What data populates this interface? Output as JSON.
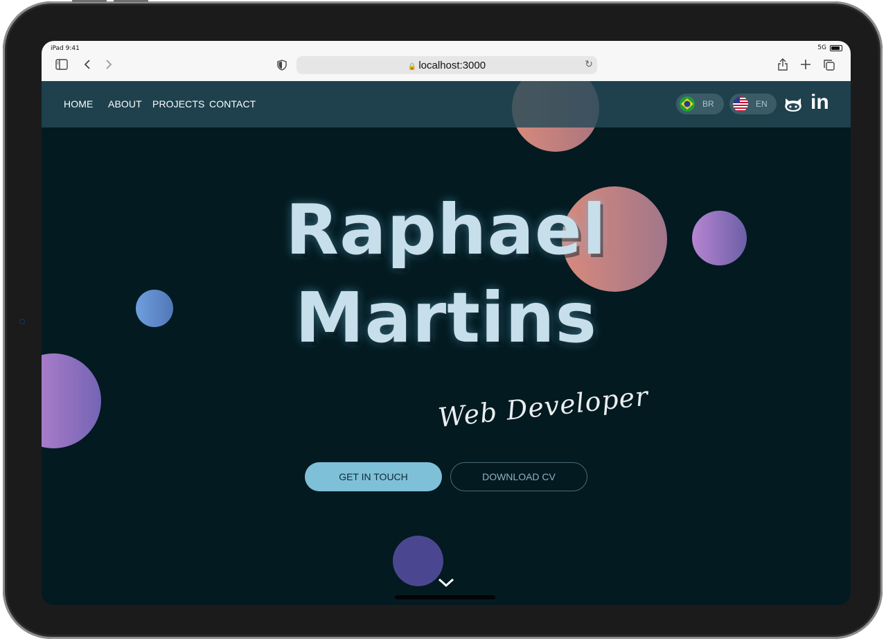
{
  "device": {
    "status_time": "iPad 9:41",
    "status_network": "5G"
  },
  "browser": {
    "url": "localhost:3000",
    "icons": [
      "sidebar-icon",
      "back-icon",
      "forward-icon",
      "shield-icon",
      "lock-icon",
      "reload-icon",
      "share-icon",
      "new-tab-icon",
      "tabs-icon"
    ]
  },
  "nav": {
    "links": [
      "HOME",
      "ABOUT",
      "PROJECTS",
      "CONTACT"
    ],
    "languages": [
      {
        "code": "BR",
        "flag": "brazil-flag-icon"
      },
      {
        "code": "EN",
        "flag": "us-flag-icon"
      }
    ],
    "social": [
      "github-icon",
      "linkedin-icon"
    ],
    "linkedin_text": "in"
  },
  "hero": {
    "first_name": "Raphael",
    "last_name": "Martins",
    "subtitle": "Web Developer",
    "primary_button": "GET IN TOUCH",
    "secondary_button": "DOWNLOAD CV",
    "scroll_icon": "chevron-down-icon"
  },
  "colors": {
    "background": "#031a20",
    "navbar": "#244a58",
    "title": "#c7dfeb",
    "primary_button": "#7ec0d7",
    "blob_salmon": "#d98a7c",
    "blob_purple": "#a17ac8",
    "blob_blue": "#5f8fcf",
    "blob_indigo": "#4a4790"
  }
}
